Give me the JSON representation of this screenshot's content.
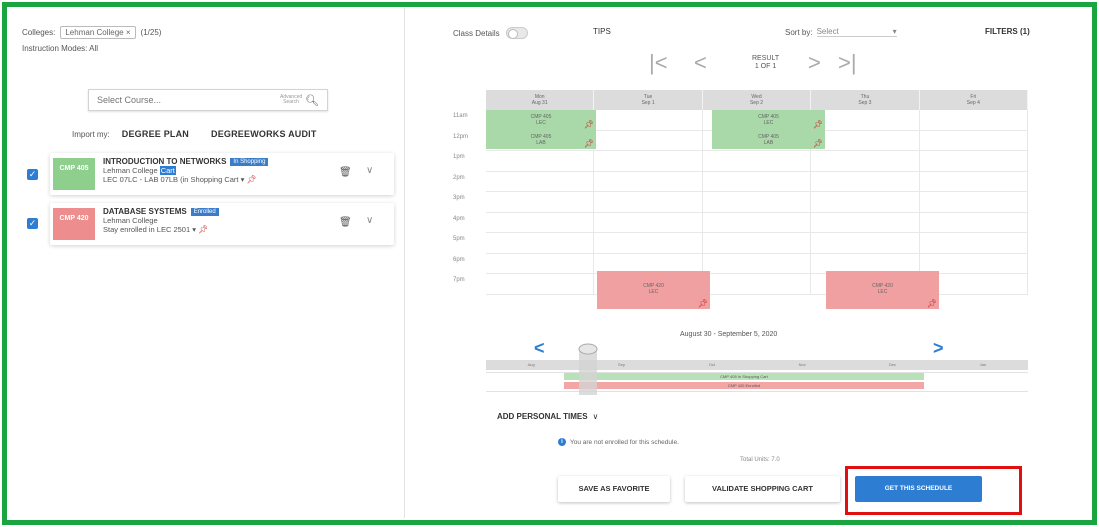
{
  "filters_left": {
    "college_label": "Colleges:",
    "college_value": "Lehman College",
    "college_count": "(1/25)",
    "instruction_modes_label": "Instruction Modes:",
    "instruction_modes_value": "All"
  },
  "search": {
    "placeholder": "Select Course...",
    "hint": "Advanced Search"
  },
  "import": {
    "label": "Import my:",
    "degree_plan": "DEGREE PLAN",
    "degreeworks": "DEGREEWORKS AUDIT"
  },
  "courses": [
    {
      "badge": "CMP 405",
      "title": "INTRODUCTION TO NETWORKS",
      "status": "In Shopping",
      "college": "Lehman College",
      "college_tag": "Cart",
      "sections": "LEC 07LC - LAB 07LB (in Shopping Cart",
      "color": "#8ecf8e"
    },
    {
      "badge": "CMP 420",
      "title": "DATABASE SYSTEMS",
      "status": "Enrolled",
      "college": "Lehman College",
      "sections": "Stay enrolled in LEC 2501",
      "color": "#ee8d8d"
    }
  ],
  "toolbar": {
    "class_details": "Class Details",
    "tips": "TIPS",
    "sort_label": "Sort by:",
    "sort_value": "Select",
    "filters": "FILTERS (1)"
  },
  "result": {
    "line1": "RESULT",
    "line2": "1 OF 1"
  },
  "calendar": {
    "days": [
      {
        "name": "Mon",
        "date": "Aug 31"
      },
      {
        "name": "Tue",
        "date": "Sep 1"
      },
      {
        "name": "Wed",
        "date": "Sep 2"
      },
      {
        "name": "Thu",
        "date": "Sep 3"
      },
      {
        "name": "Fri",
        "date": "Sep 4"
      }
    ],
    "times": [
      "11am",
      "12pm",
      "1pm",
      "2pm",
      "3pm",
      "4pm",
      "5pm",
      "6pm",
      "7pm"
    ],
    "events": [
      {
        "label": "CMP 405",
        "sub": "LEC"
      },
      {
        "label": "CMP 405",
        "sub": "LAB"
      },
      {
        "label": "CMP 405",
        "sub": "LEC"
      },
      {
        "label": "CMP 405",
        "sub": "LAB"
      },
      {
        "label": "CMP 420",
        "sub": "LEC"
      },
      {
        "label": "CMP 420",
        "sub": "LEC"
      }
    ]
  },
  "week_nav": {
    "range": "August 30 - September 5, 2020"
  },
  "timeline": {
    "months": [
      "Aug",
      "Sep",
      "Oct",
      "Nov",
      "Dec",
      "Jan"
    ],
    "bar_green": "CMP 405 In Shopping Cart",
    "bar_red": "CMP 420 Enrolled"
  },
  "personal": {
    "add_label": "ADD PERSONAL TIMES"
  },
  "notice": {
    "text": "You are not enrolled for this schedule."
  },
  "units": {
    "text": "Total Units: 7.0"
  },
  "buttons": {
    "save_favorite": "SAVE AS FAVORITE",
    "validate": "VALIDATE SHOPPING CART",
    "get_schedule": "GET THIS SCHEDULE"
  }
}
